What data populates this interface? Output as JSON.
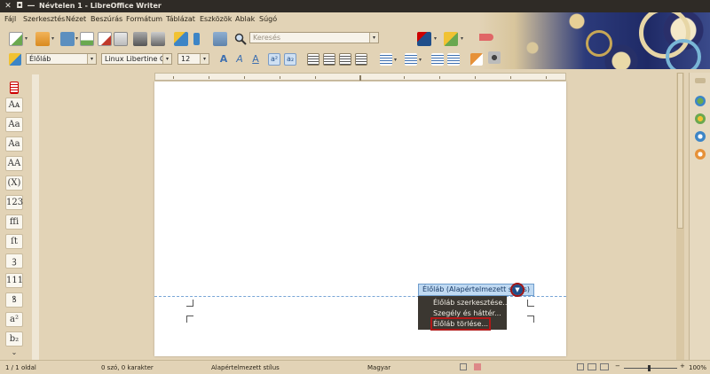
{
  "window": {
    "title": "Névtelen 1 - LibreOffice Writer",
    "close_glyph": "✕",
    "restore_glyph": "◘",
    "minimize_glyph": "—"
  },
  "menu": [
    {
      "key": "fajl",
      "label": "Fájl"
    },
    {
      "key": "szerkesztes",
      "label": "Szerkesztés"
    },
    {
      "key": "nezet",
      "label": "Nézet"
    },
    {
      "key": "beszuras",
      "label": "Beszúrás"
    },
    {
      "key": "formatum",
      "label": "Formátum"
    },
    {
      "key": "tablazat",
      "label": "Táblázat"
    },
    {
      "key": "eszkozok",
      "label": "Eszközök"
    },
    {
      "key": "ablak",
      "label": "Ablak"
    },
    {
      "key": "sugo",
      "label": "Súgó"
    }
  ],
  "toolbar": {
    "search_placeholder": "Keresés",
    "paragraph_style": "Élőláb",
    "font_name": "Linux Libertine G",
    "font_size": "12"
  },
  "fontwork": [
    "Aᴀ",
    "Aa",
    "Aa",
    "AA",
    "(X)",
    "123",
    "ffi",
    "ſt",
    "ꝫ",
    "111",
    "ꝸ",
    "a²",
    "b₂",
    "⌄"
  ],
  "footer": {
    "tag_label": "Élőláb (Alapértelmezett stílus)",
    "menu": {
      "edit": "Élőláb szerkesztése...",
      "border": "Szegély és háttér...",
      "delete": "Élőláb törlése..."
    }
  },
  "status": {
    "page": "1 / 1 oldal",
    "words": "0 szó, 0 karakter",
    "style": "Alapértelmezett stílus",
    "language": "Magyar",
    "zoom": "100%"
  },
  "colors": {
    "accent": "#1f4e8a",
    "highlight": "#b01818",
    "chrome": "#e2d3b6"
  }
}
